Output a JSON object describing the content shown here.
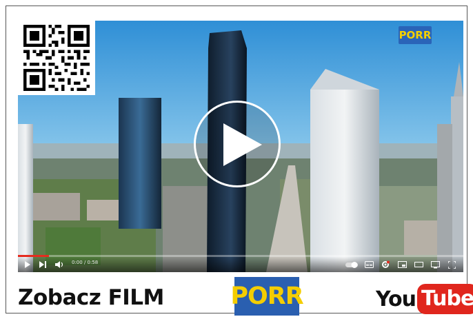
{
  "video": {
    "watermark_label": "PORR",
    "progress_fraction": 0.07,
    "time_display": "0:00 / 0:58",
    "progress_color": "#e52c1f"
  },
  "qr": {
    "icon": "qr-code-icon"
  },
  "controls": {
    "icons": [
      "play-icon",
      "next-icon",
      "volume-icon",
      "autoplay-toggle-icon",
      "subtitles-icon",
      "settings-icon",
      "miniplayer-icon",
      "theater-mode-icon",
      "cast-icon",
      "fullscreen-icon"
    ]
  },
  "footer": {
    "title": "Zobacz FILM",
    "porr_logo": "PORR",
    "youtube_you": "You",
    "youtube_tube": "Tube",
    "brand_blue": "#2a5fb0",
    "brand_yellow": "#f4cd00",
    "youtube_red": "#e0261d"
  }
}
